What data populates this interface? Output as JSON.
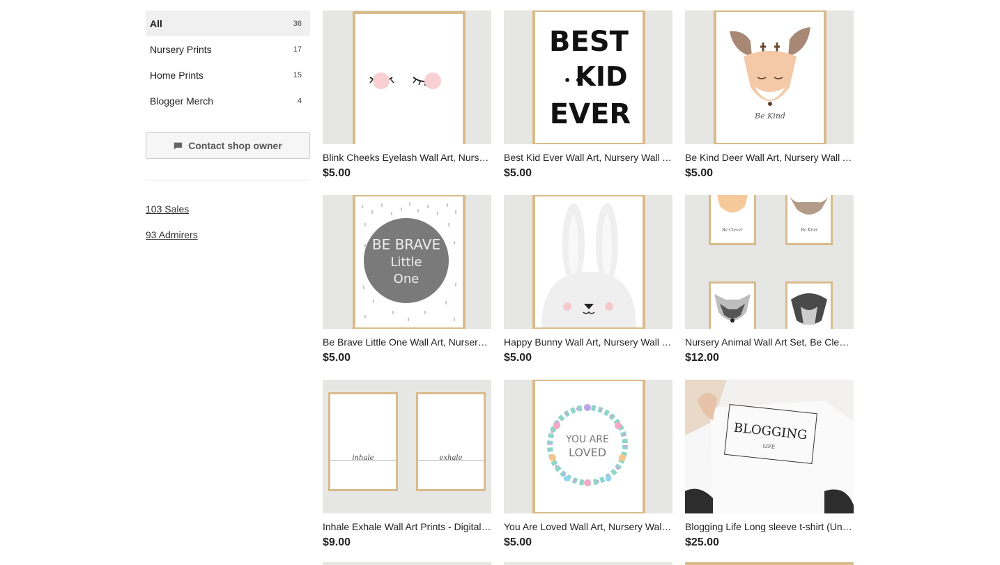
{
  "sidebar": {
    "categories": [
      {
        "label": "All",
        "count": "36"
      },
      {
        "label": "Nursery Prints",
        "count": "17"
      },
      {
        "label": "Home Prints",
        "count": "15"
      },
      {
        "label": "Blogger Merch",
        "count": "4"
      }
    ],
    "contact_label": "Contact shop owner",
    "sales": "103 Sales",
    "admirers": "93 Admirers"
  },
  "listings": [
    {
      "title": "Blink Cheeks Eyelash Wall Art, Nursery Wall Art, Printable",
      "price": "$5.00"
    },
    {
      "title": "Best Kid Ever Wall Art, Nursery Wall Art, Printable",
      "price": "$5.00"
    },
    {
      "title": "Be Kind Deer Wall Art, Nursery Wall Art, Printable",
      "price": "$5.00"
    },
    {
      "title": "Be Brave Little One Wall Art, Nursery Wall Art, Printable",
      "price": "$5.00"
    },
    {
      "title": "Happy Bunny Wall Art, Nursery Wall Art, Printable",
      "price": "$5.00"
    },
    {
      "title": "Nursery Animal Wall Art Set, Be Clever, Be Kind",
      "price": "$12.00"
    },
    {
      "title": "Inhale Exhale Wall Art Prints - Digital Download",
      "price": "$9.00"
    },
    {
      "title": "You Are Loved Wall Art, Nursery Wall Art, Printable",
      "price": "$5.00"
    },
    {
      "title": "Blogging Life Long sleeve t-shirt (Unisex)",
      "price": "$25.00"
    }
  ],
  "art_text": {
    "best_kid_ever": [
      "BEST",
      "KID",
      "EVER"
    ],
    "be_kind": "Be Kind",
    "be_brave": [
      "BE BRAVE",
      "Little",
      "One"
    ],
    "be_clever": "Be Clever",
    "inhale": "inhale",
    "exhale": "exhale",
    "you_are_loved": [
      "YOU ARE",
      "LOVED"
    ],
    "blogging": "BLOGGING",
    "life": "LIFE"
  },
  "icons": {
    "contact": "message-icon"
  }
}
